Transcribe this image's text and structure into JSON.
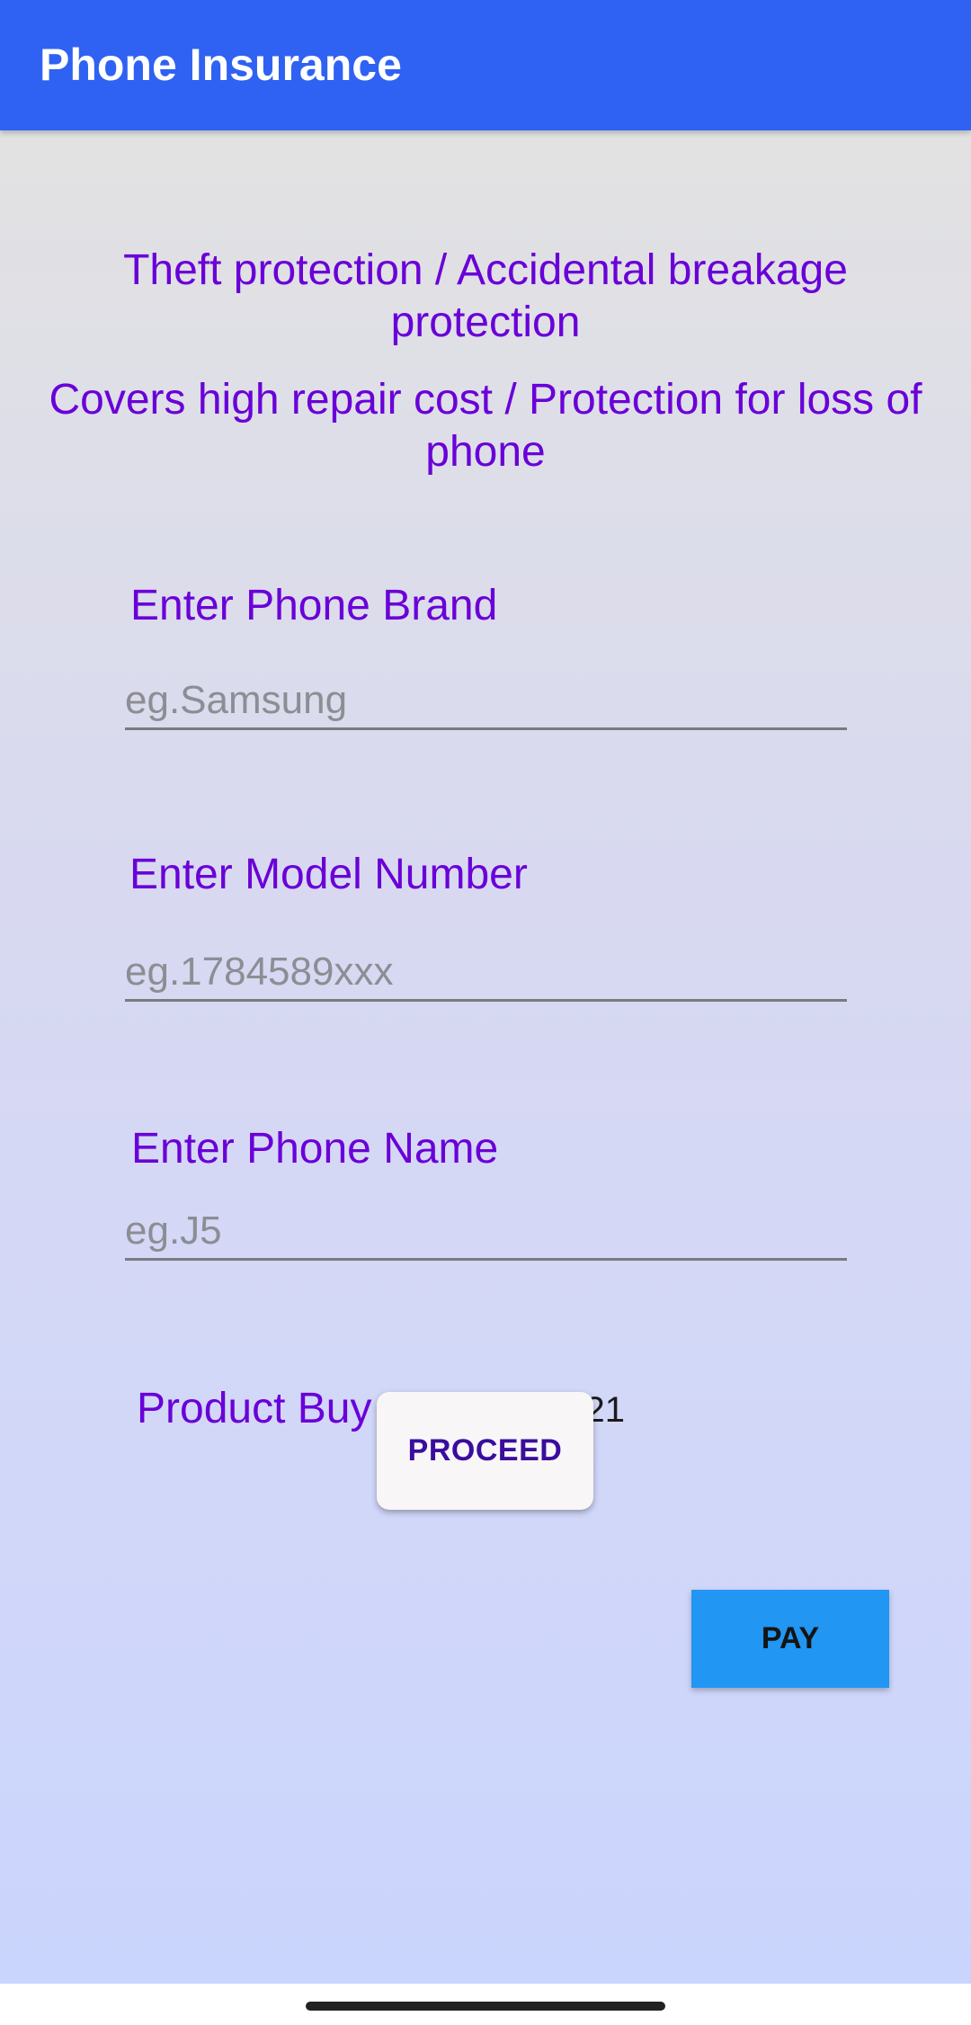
{
  "appbar": {
    "title": "Phone Insurance"
  },
  "headlines": [
    "Theft protection / Accidental breakage protection",
    "Covers high repair cost / Protection for loss of phone"
  ],
  "form": {
    "brand": {
      "label": "Enter Phone Brand",
      "placeholder": "eg.Samsung",
      "value": ""
    },
    "model": {
      "label": "Enter Model Number",
      "placeholder": "eg.1784589xxx",
      "value": ""
    },
    "name": {
      "label": "Enter Phone Name",
      "placeholder": "eg.J5",
      "value": ""
    },
    "buy_date": {
      "label": "Product Buy Date",
      "value": "2021"
    }
  },
  "buttons": {
    "proceed": "PROCEED",
    "pay": "PAY"
  },
  "colors": {
    "appbar": "#2f62f2",
    "accent_text": "#6a00d8",
    "pay_button": "#2196f3",
    "proceed_text": "#3a0d9e"
  }
}
